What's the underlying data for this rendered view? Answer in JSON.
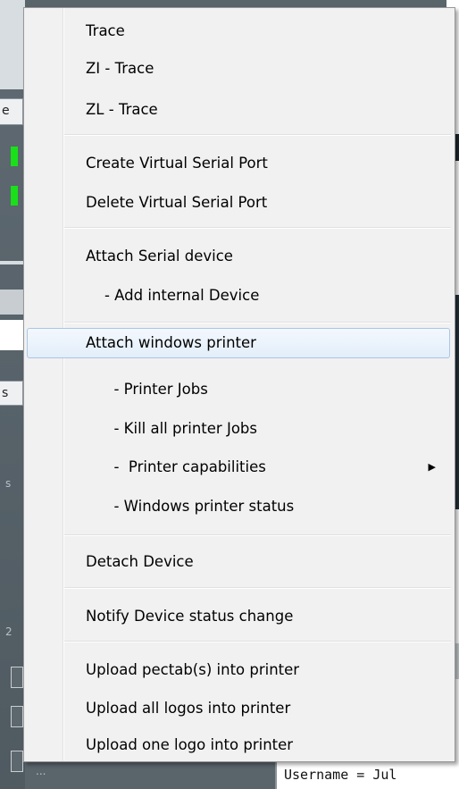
{
  "menu": {
    "items": [
      {
        "label": "Trace"
      },
      {
        "label": "ZI - Trace"
      },
      {
        "label": "ZL - Trace"
      },
      {
        "label": "Create Virtual Serial Port"
      },
      {
        "label": "Delete Virtual Serial Port"
      },
      {
        "label": "Attach Serial device"
      },
      {
        "label": "    - Add internal Device"
      },
      {
        "label": "Attach windows printer",
        "highlighted": true
      },
      {
        "label": "      - Printer Jobs"
      },
      {
        "label": "      - Kill all printer Jobs"
      },
      {
        "label": "      -  Printer capabilities",
        "submenu": true
      },
      {
        "label": "      - Windows printer status"
      },
      {
        "label": "Detach Device"
      },
      {
        "label": "Notify Device status change"
      },
      {
        "label": "Upload pectab(s) into printer"
      },
      {
        "label": "Upload all logos into printer"
      },
      {
        "label": "Upload one logo into printer"
      }
    ],
    "submenu_arrow": "▶"
  },
  "background": {
    "tab1_fragment": "e",
    "tab2_fragment": "s",
    "hint_fragment_1": "s",
    "hint_fragment_2": "2",
    "hint_fragment_3": "...",
    "console_text": "Username = Jul"
  },
  "colors": {
    "menu_background": "#f1f1f1",
    "highlight_border": "#a9c6e6",
    "indicator_green": "#19e019"
  }
}
